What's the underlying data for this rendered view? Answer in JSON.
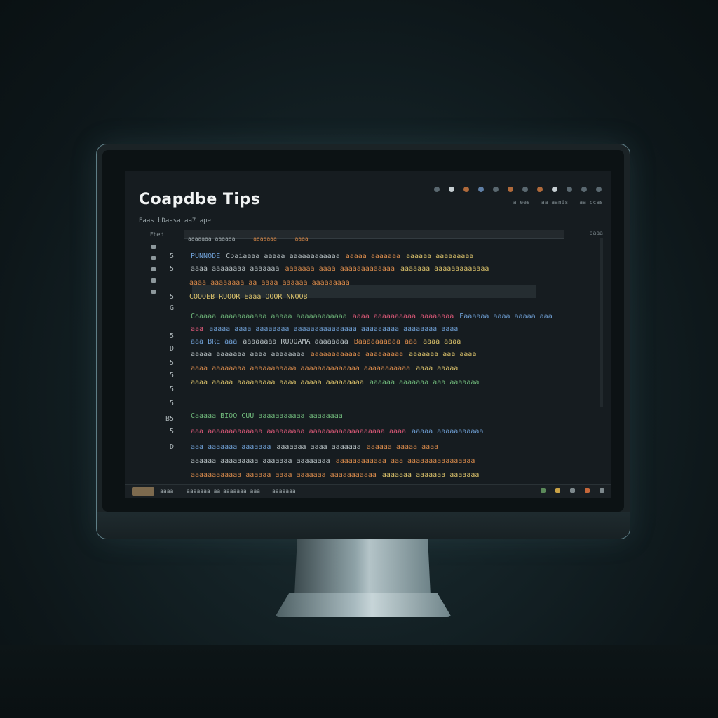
{
  "screen": {
    "title": "Coapdbe Tips",
    "subtitle": "Eaas bDaasa  aa7 ape",
    "top_labels": [
      "a  ees",
      "aa  aanis",
      "aa  ccas"
    ],
    "tab_labels": [
      "aaaaaaa aaaaaa",
      "aaaaaaa",
      "aaaa"
    ],
    "sidebar_label": "Ebed",
    "right_label": "aaaa",
    "status_items": [
      "aaaa",
      "aaaaaaa aa",
      "aaaaaaa aaa",
      "aaaaaaa"
    ],
    "code_lines": [
      [
        "PUNNODE",
        "Cbaiaaaa aaaaa aaaaaaaaaaaa",
        "aaaaa aaaaaaa",
        "aaaaaa aaaaaaaaa"
      ],
      [
        "aaaa aaaaaaaa aaaaaaa",
        "aaaaaaa aaaa aaaaaaaaaaaaa",
        "aaaaaaa aaaaaaaaaaaaa"
      ],
      [
        "aaaa aaaaaaaa aa aaaa aaaaaa aaaaaaaaa"
      ],
      [
        "COOOEB RUOOR Eaaa OOOR NNOOB"
      ],
      [
        "Coaaaa aaaaaaaaaaa aaaaa aaaaaaaaaaaa",
        "aaaa aaaaaaaaaa aaaaaaaa",
        "Eaaaaaa aaaa aaaaa aaa"
      ],
      [
        "aaa",
        "aaaaa aaaa aaaaaaaa aaaaaaaaaaaaaaa aaaaaaaaa aaaaaaaa aaaa"
      ],
      [
        "aaa BRE aaa",
        "aaaaaaaa RUOOAMA aaaaaaaa",
        "Baaaaaaaaaa aaa",
        "aaaa aaaa"
      ],
      [
        "aaaaa aaaaaaa aaaa aaaaaaaa",
        "aaaaaaaaaaaa aaaaaaaaa",
        "aaaaaaa aaa aaaa"
      ],
      [
        "aaaa aaaaaaaa aaaaaaaaaaa aaaaaaaaaaaaaa aaaaaaaaaaa",
        "aaaa aaaaa"
      ],
      [
        "aaaa aaaaa aaaaaaaaa aaaa aaaaa aaaaaaaaa",
        "aaaaaa aaaaaaa aaa aaaaaaa"
      ],
      [
        "Caaaaa BIOO CUU aaaaaaaaaaa aaaaaaaa"
      ],
      [
        "aaa aaaaaaaaaaaaa aaaaaaaaa aaaaaaaaaaaaaaaaaa aaaa",
        "aaaaa aaaaaaaaaaa"
      ],
      [
        "aaa aaaaaaa aaaaaaa",
        "aaaaaaa aaaa aaaaaaa",
        "aaaaaa aaaaa aaaa"
      ],
      [
        "aaaaaa aaaaaaaaa aaaaaaa aaaaaaaa",
        "aaaaaaaaaaaa aaa aaaaaaaaaaaaaaaa"
      ],
      [
        "aaaaaaaaaaaa aaaaaa aaaa aaaaaaa aaaaaaaaaaa",
        "aaaaaaa aaaaaaa aaaaaaa"
      ]
    ],
    "gutter": [
      "5",
      "5",
      "5",
      "G",
      "5",
      "D",
      "5",
      "5",
      "5",
      "5",
      "B5",
      "5",
      "D"
    ]
  },
  "colors": {
    "accent_orange": "#d6894b",
    "accent_blue": "#6f9fd4",
    "accent_green": "#6fb77a",
    "accent_pink": "#e05a7a"
  }
}
